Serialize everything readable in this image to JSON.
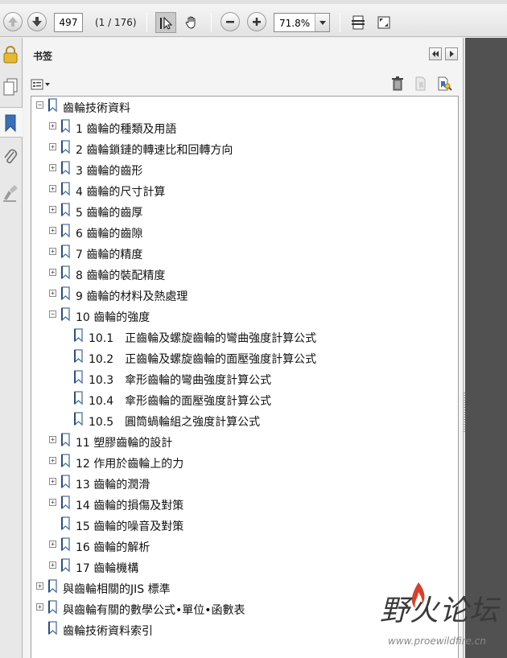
{
  "toolbar": {
    "page_number": "497",
    "page_count": "(1 / 176)",
    "zoom": "71.8%"
  },
  "panel": {
    "title": "书签"
  },
  "bookmarks": [
    {
      "label": "齒輪技術資料",
      "level": 0,
      "expander": "−"
    },
    {
      "label": "1 齒輪的種類及用語",
      "level": 1,
      "expander": "+"
    },
    {
      "label": "2 齒輪鎖鏈的轉速比和回轉方向",
      "level": 1,
      "expander": "+"
    },
    {
      "label": "3 齒輪的齒形",
      "level": 1,
      "expander": "+"
    },
    {
      "label": "4 齒輪的尺寸計算",
      "level": 1,
      "expander": "+"
    },
    {
      "label": "5 齒輪的齒厚",
      "level": 1,
      "expander": "+"
    },
    {
      "label": "6 齒輪的齒隙",
      "level": 1,
      "expander": "+"
    },
    {
      "label": "7 齒輪的精度",
      "level": 1,
      "expander": "+"
    },
    {
      "label": "8 齒輪的裝配精度",
      "level": 1,
      "expander": "+"
    },
    {
      "label": "9 齒輪的材料及熱處理",
      "level": 1,
      "expander": "+"
    },
    {
      "label": "10 齒輪的強度",
      "level": 1,
      "expander": "−"
    },
    {
      "label": "10.1　正齒輪及螺旋齒輪的彎曲強度計算公式",
      "level": 2,
      "expander": ""
    },
    {
      "label": "10.2　正齒輪及螺旋齒輪的面壓強度計算公式",
      "level": 2,
      "expander": ""
    },
    {
      "label": "10.3　傘形齒輪的彎曲強度計算公式",
      "level": 2,
      "expander": ""
    },
    {
      "label": "10.4　傘形齒輪的面壓強度計算公式",
      "level": 2,
      "expander": ""
    },
    {
      "label": "10.5　圓筒蝸輪組之強度計算公式",
      "level": 2,
      "expander": ""
    },
    {
      "label": "11 塑膠齒輪的設計",
      "level": 1,
      "expander": "+"
    },
    {
      "label": "12 作用於齒輪上的力",
      "level": 1,
      "expander": "+"
    },
    {
      "label": "13 齒輪的潤滑",
      "level": 1,
      "expander": "+"
    },
    {
      "label": "14 齒輪的損傷及對策",
      "level": 1,
      "expander": "+"
    },
    {
      "label": "15 齒輪的噪音及對策",
      "level": 1,
      "expander": ""
    },
    {
      "label": "16 齒輪的解析",
      "level": 1,
      "expander": "+"
    },
    {
      "label": "17 齒輪機構",
      "level": 1,
      "expander": "+"
    },
    {
      "label": "與齒輪相關的JIS 標準",
      "level": 0,
      "expander": "+"
    },
    {
      "label": "與齒輪有關的數學公式•單位•函數表",
      "level": 0,
      "expander": "+"
    },
    {
      "label": "齒輪技術資料索引",
      "level": 0,
      "expander": ""
    }
  ],
  "watermark": {
    "text": "野火论坛",
    "url": "www.proewildfire.cn"
  },
  "colors": {
    "doc_background": "#515151",
    "bookmark_icon": "#4a6fa5",
    "flame": "#d8402a"
  }
}
